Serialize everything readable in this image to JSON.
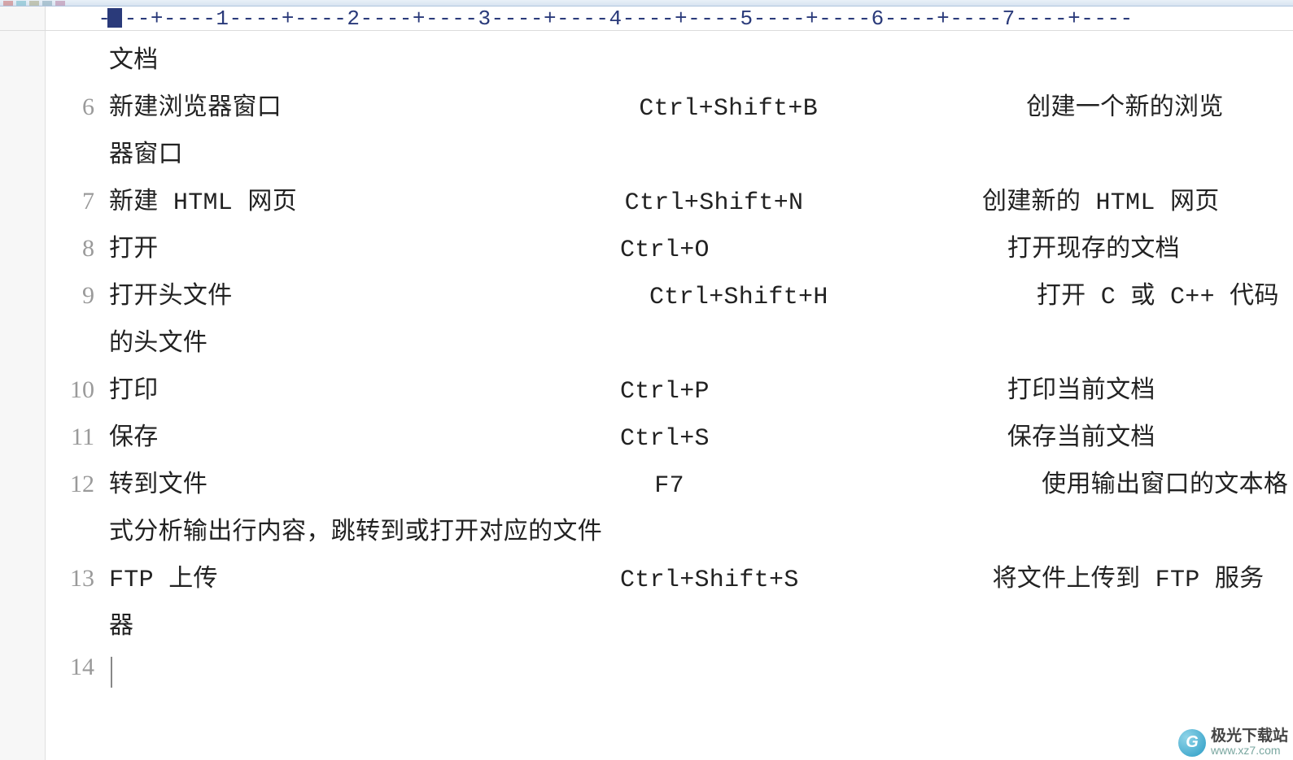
{
  "ruler": {
    "numbers": [
      1,
      2,
      3,
      4,
      5,
      6,
      7
    ]
  },
  "lines": [
    {
      "num": "",
      "text": "文档"
    },
    {
      "num": "6",
      "text": "新建浏览器窗口                        Ctrl+Shift+B              创建一个新的浏览"
    },
    {
      "num": "",
      "text": "器窗口"
    },
    {
      "num": "7",
      "text": "新建 HTML 网页                      Ctrl+Shift+N            创建新的 HTML 网页"
    },
    {
      "num": "8",
      "text": "打开                               Ctrl+O                    打开现存的文档"
    },
    {
      "num": "9",
      "text": "打开头文件                            Ctrl+Shift+H              打开 C 或 C++ 代码"
    },
    {
      "num": "",
      "text": "的头文件"
    },
    {
      "num": "10",
      "text": "打印                               Ctrl+P                    打印当前文档"
    },
    {
      "num": "11",
      "text": "保存                               Ctrl+S                    保存当前文档"
    },
    {
      "num": "12",
      "text": "转到文件                              F7                        使用输出窗口的文本格"
    },
    {
      "num": "",
      "text": "式分析输出行内容，跳转到或打开对应的文件"
    },
    {
      "num": "13",
      "text": "FTP 上传                           Ctrl+Shift+S             将文件上传到 FTP 服务"
    },
    {
      "num": "",
      "text": "器"
    },
    {
      "num": "14",
      "text": ""
    }
  ],
  "watermark": {
    "title": "极光下载站",
    "url": "www.xz7.com"
  }
}
